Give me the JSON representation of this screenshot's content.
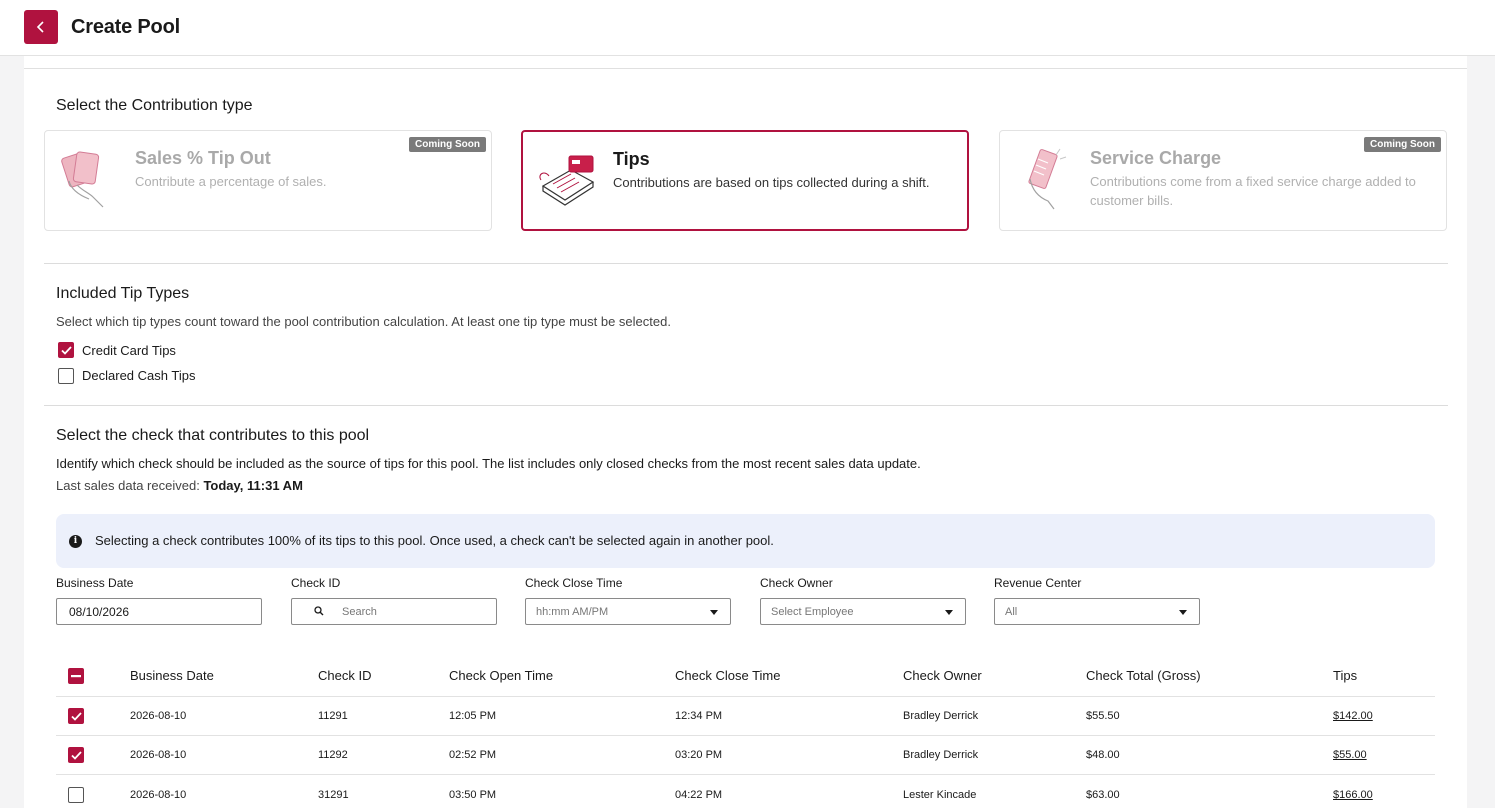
{
  "header": {
    "title": "Create Pool",
    "back_icon": "chevron-left-icon"
  },
  "contribution": {
    "heading": "Select the Contribution type",
    "cards": [
      {
        "title": "Sales % Tip Out",
        "desc": "Contribute a percentage of sales.",
        "badge": "Coming Soon",
        "state": "disabled",
        "icon": "hand-cards-icon"
      },
      {
        "title": "Tips",
        "desc": "Contributions are based on tips collected during a shift.",
        "badge": "",
        "state": "selected",
        "icon": "card-terminal-icon"
      },
      {
        "title": "Service Charge",
        "desc": "Contributions come from a fixed service charge added to customer bills.",
        "badge": "Coming Soon",
        "state": "disabled",
        "icon": "hand-receipt-icon"
      }
    ]
  },
  "tip_types": {
    "heading": "Included Tip Types",
    "desc": "Select which tip types count toward the pool contribution calculation. At least one tip type must be selected.",
    "options": [
      {
        "label": "Credit Card Tips",
        "checked": true
      },
      {
        "label": "Declared Cash Tips",
        "checked": false
      }
    ]
  },
  "check_select": {
    "heading": "Select the check that contributes to this pool",
    "desc": "Identify which check should be included as the source of tips for this pool. The list includes only closed checks from the most recent sales data update.",
    "last_received_label": "Last sales data received:",
    "last_received_value": "Today, 11:31 AM",
    "info": "Selecting a check contributes 100% of its tips to this pool. Once used, a check can't be selected again in another pool."
  },
  "filters": {
    "business_date": {
      "label": "Business Date",
      "value": "08/10/2026"
    },
    "check_id": {
      "label": "Check ID",
      "placeholder": "Search"
    },
    "check_close_time": {
      "label": "Check Close Time",
      "placeholder": "hh:mm AM/PM"
    },
    "check_owner": {
      "label": "Check Owner",
      "placeholder": "Select Employee"
    },
    "revenue_center": {
      "label": "Revenue Center",
      "value": "All"
    }
  },
  "table": {
    "columns": [
      "Business Date",
      "Check ID",
      "Check Open Time",
      "Check Close Time",
      "Check Owner",
      "Check Total (Gross)",
      "Tips"
    ],
    "header_checkbox": "indeterminate",
    "rows": [
      {
        "checked": true,
        "cells": [
          "2026-08-10",
          "11291",
          "12:05 PM",
          "12:34 PM",
          "Bradley Derrick",
          "$55.50",
          "$142.00"
        ]
      },
      {
        "checked": true,
        "cells": [
          "2026-08-10",
          "11292",
          "02:52 PM",
          "03:20 PM",
          "Bradley Derrick",
          "$48.00",
          "$55.00"
        ]
      },
      {
        "checked": false,
        "cells": [
          "2026-08-10",
          "31291",
          "03:50 PM",
          "04:22 PM",
          "Lester Kincade",
          "$63.00",
          "$166.00"
        ]
      }
    ]
  },
  "colors": {
    "accent": "#b0123f",
    "info_bg": "#ecf0fb"
  }
}
